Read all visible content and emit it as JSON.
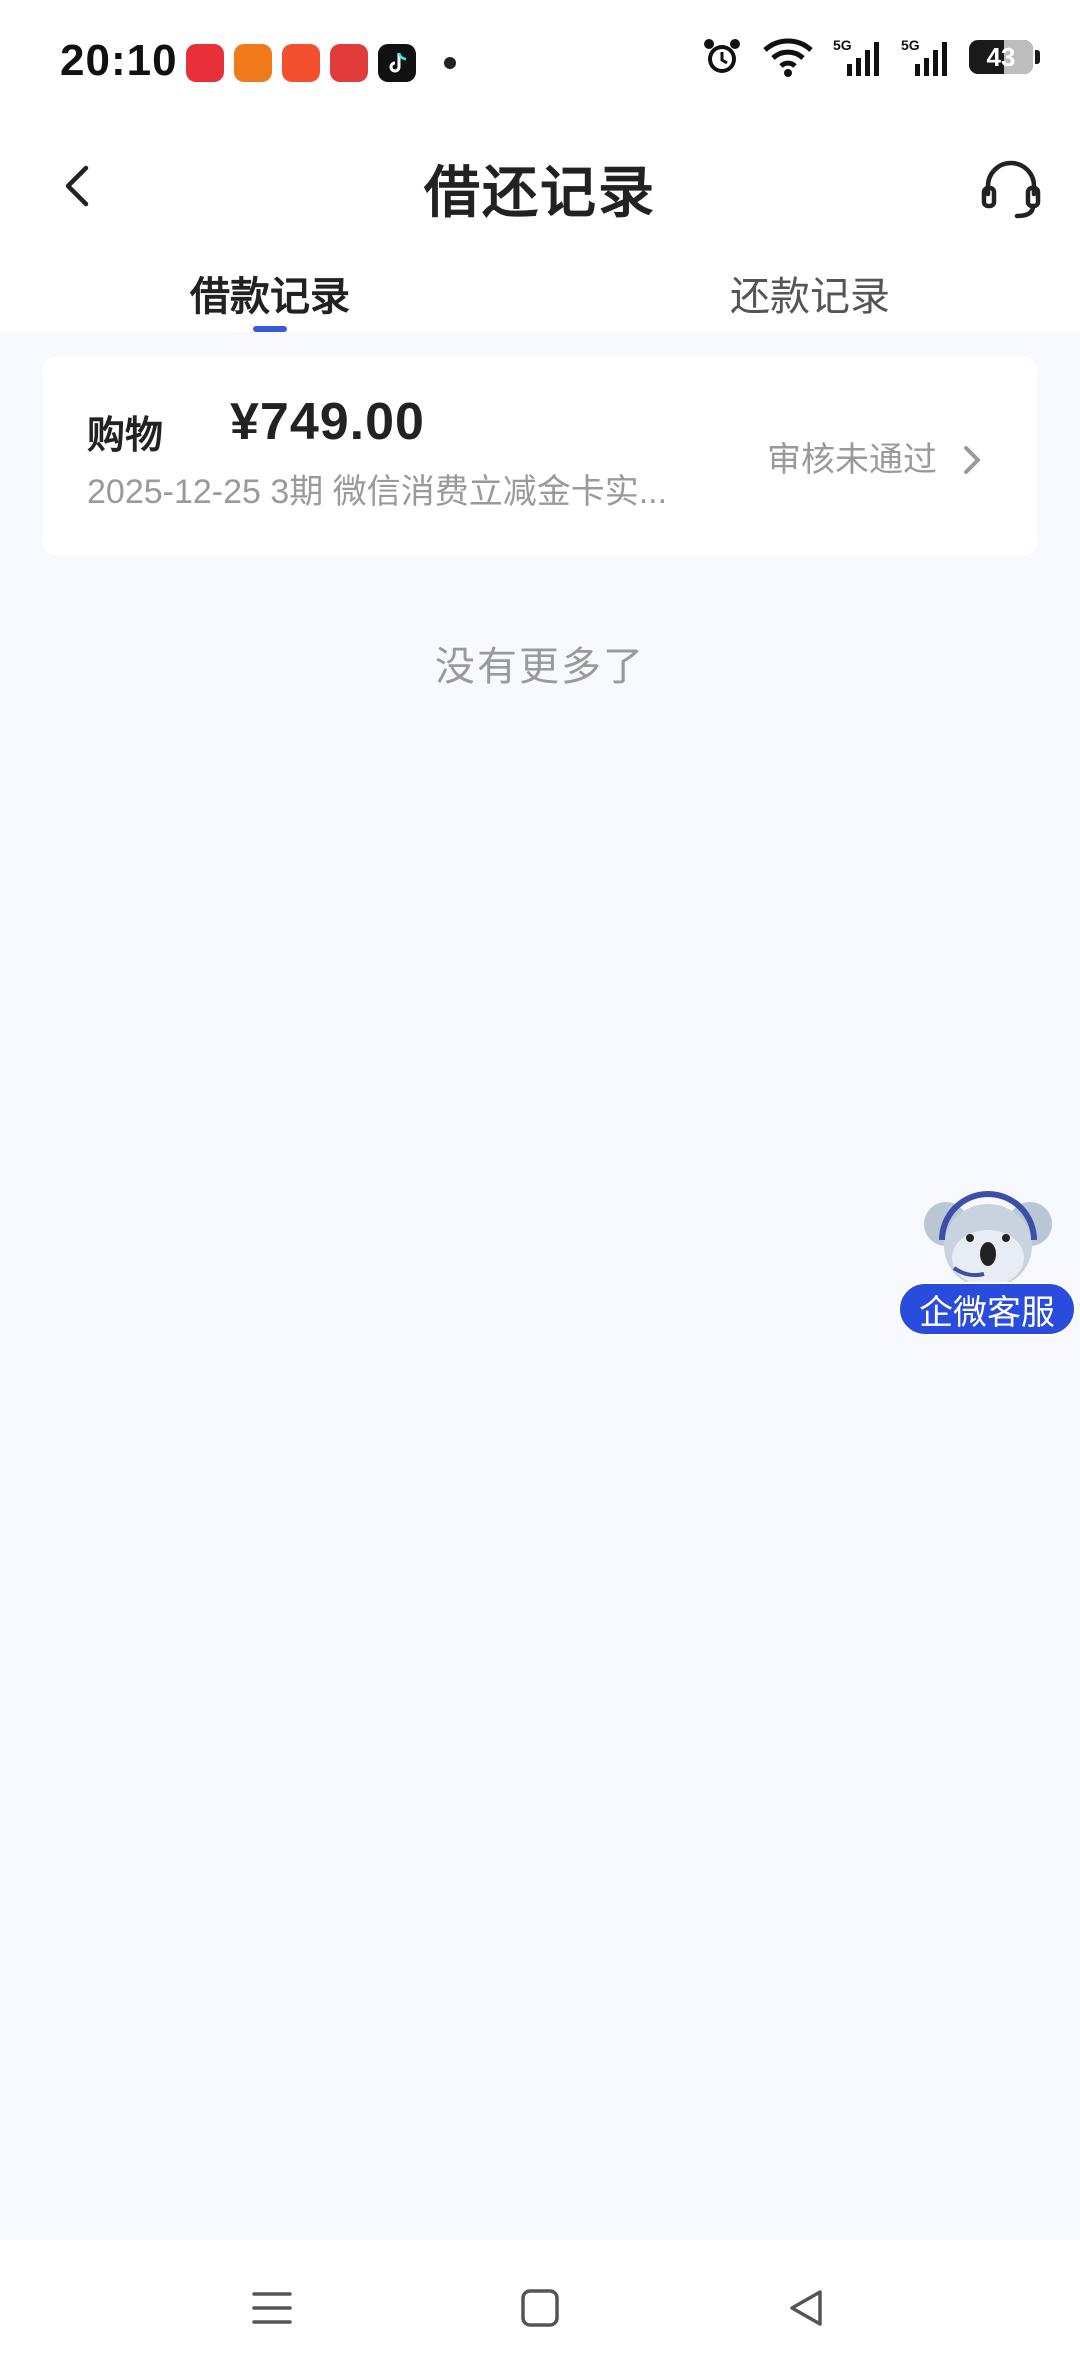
{
  "status_bar": {
    "time": "20:10",
    "app_icons": [
      "app-icon-1",
      "app-icon-2",
      "app-icon-3",
      "app-icon-4",
      "tiktok-icon"
    ],
    "battery": "43"
  },
  "header": {
    "title": "借还记录",
    "back_icon": "chevron-left-icon",
    "service_icon": "headset-icon"
  },
  "tabs": [
    {
      "label": "借款记录",
      "active": true
    },
    {
      "label": "还款记录",
      "active": false
    }
  ],
  "records": [
    {
      "prefix": "购物",
      "amount": "¥749.00",
      "subline": "2025-12-25 3期  微信消费立减金卡实...",
      "status": "审核未通过"
    }
  ],
  "no_more_text": "没有更多了",
  "floating_service": {
    "label": "企微客服",
    "icon": "koala-headset-mascot"
  },
  "system_nav": [
    "menu-icon",
    "home-icon",
    "back-triangle-icon"
  ],
  "colors": {
    "accent": "#3a59d6",
    "floating_badge": "#2a4cdc",
    "page_bg": "#f7f9fe"
  }
}
